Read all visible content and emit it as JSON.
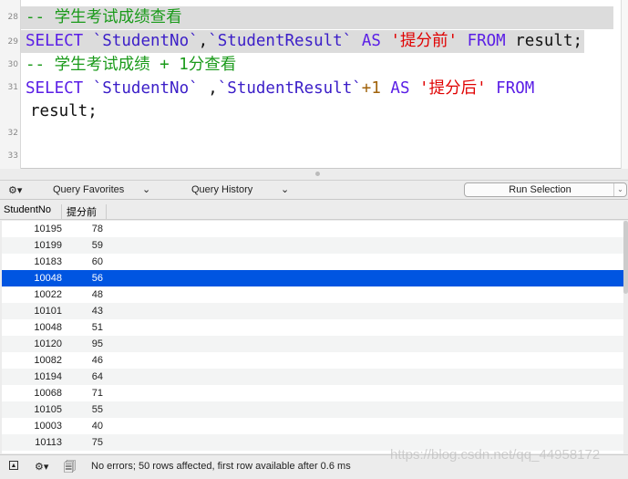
{
  "editor": {
    "line_numbers": [
      "28",
      "29",
      "30",
      "31",
      "32",
      "33"
    ],
    "line28": {
      "comment": "-- 学生考试成绩查看"
    },
    "line29": {
      "kw1": "SELECT",
      "id1": "`StudentNo`",
      "sep": ",",
      "id2": "`StudentResult`",
      "kw2": "AS",
      "str": "'提分前'",
      "kw3": "FROM",
      "tail": "result;"
    },
    "line30": {
      "comment": "-- 学生考试成绩 + 1分查看"
    },
    "line31": {
      "kw1": "SELECT",
      "id1": "`StudentNo`",
      "sep": " ,",
      "id2": "`StudentResult`",
      "num": "+1",
      "kw2": "AS",
      "str": "'提分后'",
      "kw3": "FROM",
      "wrap": "result;"
    }
  },
  "toolbar": {
    "gear_icon": "gear-icon",
    "query_favorites": "Query Favorites",
    "query_history": "Query History",
    "run_selection": "Run Selection"
  },
  "table": {
    "columns": [
      "StudentNo",
      "提分前"
    ],
    "selected_row": 3,
    "rows": [
      [
        "10195",
        "78"
      ],
      [
        "10199",
        "59"
      ],
      [
        "10183",
        "60"
      ],
      [
        "10048",
        "56"
      ],
      [
        "10022",
        "48"
      ],
      [
        "10101",
        "43"
      ],
      [
        "10048",
        "51"
      ],
      [
        "10120",
        "95"
      ],
      [
        "10082",
        "46"
      ],
      [
        "10194",
        "64"
      ],
      [
        "10068",
        "71"
      ],
      [
        "10105",
        "55"
      ],
      [
        "10003",
        "40"
      ],
      [
        "10113",
        "75"
      ]
    ]
  },
  "status": {
    "message": "No errors; 50 rows affected, first row available after 0.6 ms"
  },
  "watermark": "https://blog.csdn.net/qq_44958172",
  "colors": {
    "selection": "#0055e1",
    "comment": "#1a9a1a",
    "keyword": "#5a1ee6",
    "string": "#e00000"
  }
}
